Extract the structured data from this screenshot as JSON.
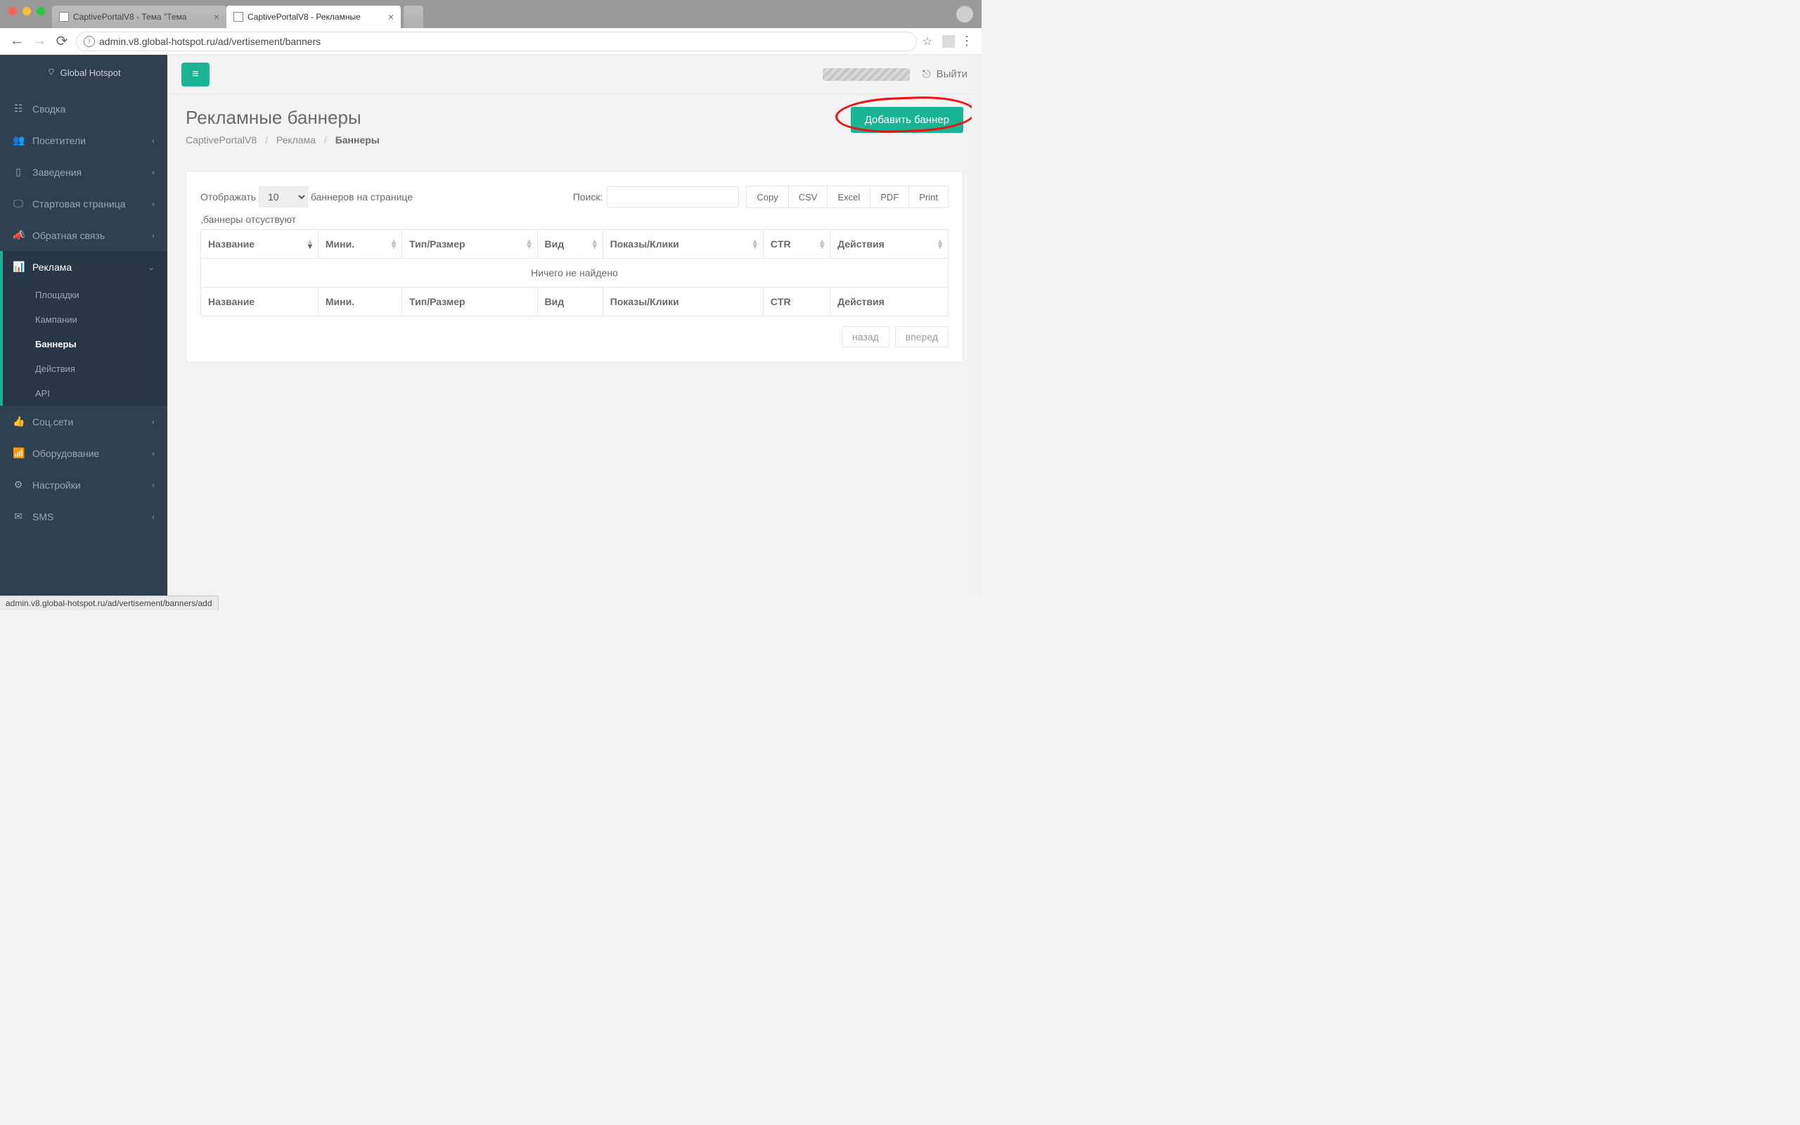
{
  "browser": {
    "tabs": [
      {
        "title": "CaptivePortalV8 - Тема \"Тема",
        "active": false
      },
      {
        "title": "CaptivePortalV8 - Рекламные",
        "active": true
      }
    ],
    "url": "admin.v8.global-hotspot.ru/ad/vertisement/banners",
    "status_url": "admin.v8.global-hotspot.ru/ad/vertisement/banners/add"
  },
  "brand": "Global Hotspot",
  "sidebar": {
    "items": [
      {
        "icon": "☷",
        "label": "Сводка",
        "chev": false
      },
      {
        "icon": "👥",
        "label": "Посетители",
        "chev": true
      },
      {
        "icon": "▯",
        "label": "Заведения",
        "chev": true
      },
      {
        "icon": "🖵",
        "label": "Стартовая страница",
        "chev": true
      },
      {
        "icon": "📣",
        "label": "Обратная связь",
        "chev": true
      },
      {
        "icon": "📊",
        "label": "Реклама",
        "chev": true,
        "active": true,
        "open": true
      },
      {
        "icon": "👍",
        "label": "Соц.сети",
        "chev": true
      },
      {
        "icon": "📶",
        "label": "Оборудование",
        "chev": true
      },
      {
        "icon": "⚙",
        "label": "Настройки",
        "chev": true
      },
      {
        "icon": "✉",
        "label": "SMS",
        "chev": true
      }
    ],
    "sub": [
      {
        "label": "Площадки"
      },
      {
        "label": "Кампании"
      },
      {
        "label": "Баннеры",
        "active": true
      },
      {
        "label": "Действия"
      },
      {
        "label": "API"
      }
    ]
  },
  "topbar": {
    "logout": "Выйти"
  },
  "page": {
    "title": "Рекламные баннеры",
    "breadcrumb": [
      "CaptivePortalV8",
      "Реклама",
      "Баннеры"
    ],
    "add_button": "Добавить баннер"
  },
  "datatable": {
    "length_pre": "Отображать",
    "length_value": "10",
    "length_post": "баннеров на странице",
    "search_label": "Поиск:",
    "export": [
      "Copy",
      "CSV",
      "Excel",
      "PDF",
      "Print"
    ],
    "empty_note": ",баннеры отсуствуют",
    "columns": [
      "Название",
      "Мини.",
      "Тип/Размер",
      "Вид",
      "Показы/Клики",
      "CTR",
      "Действия"
    ],
    "no_data": "Ничего не найдено",
    "pager_prev": "назад",
    "pager_next": "вперед"
  }
}
